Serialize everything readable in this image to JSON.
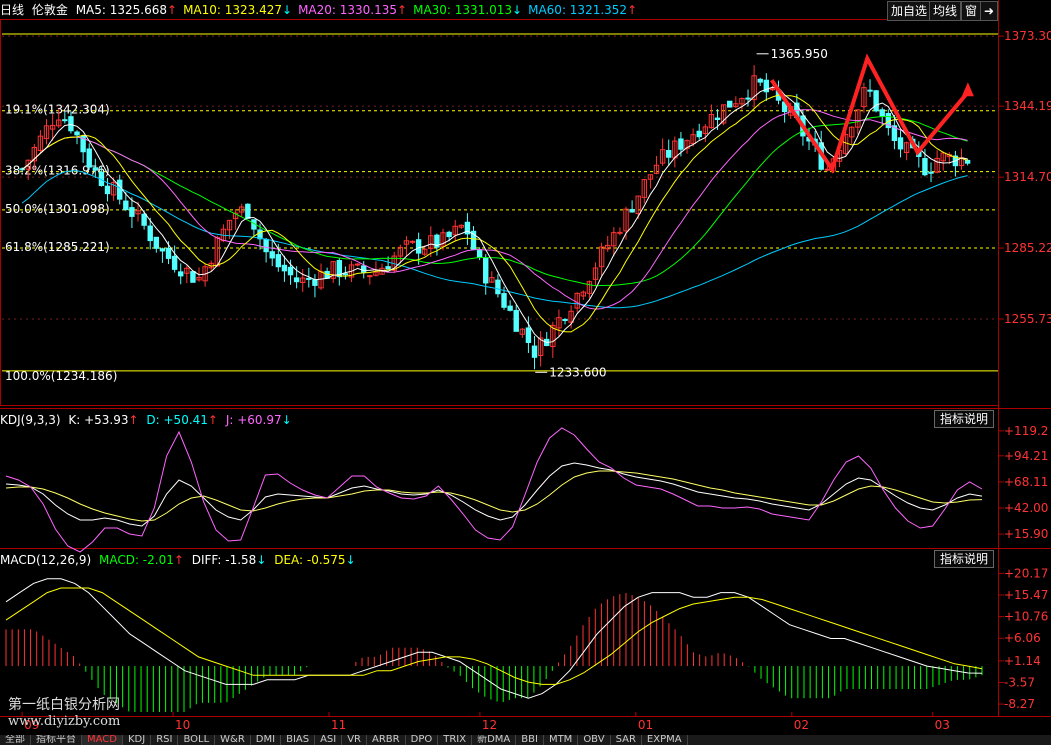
{
  "header": {
    "period": "日线",
    "name": "伦敦金",
    "ma": [
      {
        "label": "MA5: 1325.668",
        "arrow": "↑",
        "color": "#ffffff",
        "arrow_color": "#ff3333"
      },
      {
        "label": "MA10: 1323.427",
        "arrow": "↓",
        "color": "#ffff00",
        "arrow_color": "#00ffff"
      },
      {
        "label": "MA20: 1330.135",
        "arrow": "↑",
        "color": "#ff66ff",
        "arrow_color": "#ff3333"
      },
      {
        "label": "MA30: 1331.013",
        "arrow": "↓",
        "color": "#00ff00",
        "arrow_color": "#00ffff"
      },
      {
        "label": "MA60: 1321.352",
        "arrow": "↑",
        "color": "#00ccff",
        "arrow_color": "#ff3333"
      }
    ]
  },
  "toolbar": {
    "add_label": "加自选",
    "ma_label": "均线",
    "window_label": "窗",
    "arrow_label": "➜"
  },
  "price_axis": {
    "ticks": [
      "1373.303",
      "1344.194",
      "1314.707",
      "1285.221",
      "1255.734"
    ],
    "high_label": "1365.950",
    "low_label": "1233.600"
  },
  "fib_levels": [
    {
      "label": "19.1%(1342.304)",
      "value": 1342.304
    },
    {
      "label": "38.2%(1316.976)",
      "value": 1316.976
    },
    {
      "label": "50.0%(1301.098)",
      "value": 1301.098
    },
    {
      "label": "61.8%(1285.221)",
      "value": 1285.221
    },
    {
      "label": "100.0%(1234.186)",
      "value": 1234.186
    }
  ],
  "kdj": {
    "title": "KDJ(9,3,3)",
    "k": "K: +53.93",
    "k_arrow": "↑",
    "d": "D: +50.41",
    "d_arrow": "↑",
    "j": "J: +60.97",
    "j_arrow": "↓",
    "ticks": [
      "+119.2",
      "+94.21",
      "+68.11",
      "+42.00",
      "+15.90"
    ],
    "button": "指标说明"
  },
  "macd": {
    "title": "MACD(12,26,9)",
    "macd": "MACD: -2.01",
    "macd_arrow": "↑",
    "diff": "DIFF: -1.58",
    "diff_arrow": "↓",
    "dea": "DEA: -0.575",
    "dea_arrow": "↓",
    "ticks": [
      "+20.17",
      "+15.47",
      "+10.76",
      "+6.06",
      "+1.14",
      "-3.57",
      "-8.27"
    ],
    "button": "指标说明"
  },
  "x_axis": {
    "labels": [
      "09",
      "10",
      "11",
      "12",
      "01",
      "02",
      "03"
    ]
  },
  "watermark": {
    "line1": "第一纸白银分析网",
    "line2": "www.diyizby.com"
  },
  "tabs": [
    "全部",
    "指标平台",
    "MACD",
    "KDJ",
    "RSI",
    "BOLL",
    "W&R",
    "DMI",
    "BIAS",
    "ASI",
    "VR",
    "ARBR",
    "DPO",
    "TRIX",
    "新DMA",
    "BBI",
    "MTM",
    "OBV",
    "SAR",
    "EXPMA"
  ],
  "active_tab": "MACD",
  "colors": {
    "up": "#ff3333",
    "down": "#54ffff",
    "ma5": "#ffffff",
    "ma10": "#ffff00",
    "ma20": "#ff66ff",
    "ma30": "#00ff00",
    "ma60": "#00ccff",
    "grid": "#aa0000",
    "fib": "#ffff00",
    "annotation": "#ff2222"
  },
  "chart_data": [
    {
      "type": "candlestick",
      "title": "伦敦金 日线",
      "ylim": [
        1220,
        1380
      ],
      "x_labels": [
        "09",
        "10",
        "11",
        "12",
        "01",
        "02",
        "03"
      ],
      "annotations": [
        {
          "label": "1365.950",
          "x": "2018-01-25",
          "y": 1365.95
        },
        {
          "label": "1233.600",
          "x": "2017-12-12",
          "y": 1233.6
        }
      ],
      "close_path": [
        [
          "2017-09-01",
          1318
        ],
        [
          "2017-09-08",
          1342
        ],
        [
          "2017-09-11",
          1336
        ],
        [
          "2017-09-15",
          1318
        ],
        [
          "2017-09-20",
          1307
        ],
        [
          "2017-09-25",
          1295
        ],
        [
          "2017-09-29",
          1283
        ],
        [
          "2017-10-06",
          1272
        ],
        [
          "2017-10-13",
          1300
        ],
        [
          "2017-10-16",
          1301
        ],
        [
          "2017-10-20",
          1281
        ],
        [
          "2017-10-26",
          1271
        ],
        [
          "2017-11-02",
          1276
        ],
        [
          "2017-11-10",
          1275
        ],
        [
          "2017-11-16",
          1285
        ],
        [
          "2017-11-24",
          1288
        ],
        [
          "2017-11-28",
          1295
        ],
        [
          "2017-12-01",
          1278
        ],
        [
          "2017-12-06",
          1262
        ],
        [
          "2017-12-12",
          1242
        ],
        [
          "2017-12-20",
          1265
        ],
        [
          "2017-12-28",
          1292
        ],
        [
          "2018-01-05",
          1320
        ],
        [
          "2018-01-15",
          1338
        ],
        [
          "2018-01-25",
          1354
        ],
        [
          "2018-02-01",
          1340
        ],
        [
          "2018-02-08",
          1318
        ],
        [
          "2018-02-16",
          1352
        ],
        [
          "2018-02-21",
          1330
        ],
        [
          "2018-02-28",
          1318
        ],
        [
          "2018-03-02",
          1323
        ],
        [
          "2018-03-09",
          1322
        ]
      ],
      "moving_averages": {
        "MA5": 1325.668,
        "MA10": 1323.427,
        "MA20": 1330.135,
        "MA30": 1331.013,
        "MA60": 1321.352
      },
      "fibonacci": [
        {
          "pct": "19.1%",
          "value": 1342.304
        },
        {
          "pct": "38.2%",
          "value": 1316.976
        },
        {
          "pct": "50.0%",
          "value": 1301.098
        },
        {
          "pct": "61.8%",
          "value": 1285.221
        },
        {
          "pct": "100.0%",
          "value": 1234.186
        }
      ]
    },
    {
      "type": "line",
      "title": "KDJ(9,3,3)",
      "ylim": [
        5,
        125
      ],
      "series": [
        {
          "name": "K",
          "last": 53.93,
          "values": [
            66,
            65,
            63,
            56,
            45,
            36,
            30,
            30,
            32,
            30,
            26,
            24,
            34,
            56,
            70,
            64,
            52,
            40,
            33,
            30,
            40,
            53,
            56,
            55,
            54,
            53,
            52,
            57,
            62,
            64,
            61,
            59,
            56,
            55,
            56,
            60,
            55,
            48,
            40,
            34,
            30,
            33,
            45,
            60,
            74,
            84,
            87,
            85,
            82,
            80,
            76,
            73,
            71,
            69,
            66,
            62,
            58,
            56,
            54,
            52,
            51,
            49,
            46,
            44,
            42,
            40,
            46,
            56,
            66,
            72,
            70,
            62,
            54,
            47,
            42,
            40,
            45,
            52,
            56,
            53.93
          ]
        },
        {
          "name": "D",
          "last": 50.41,
          "values": [
            62,
            63,
            63,
            61,
            57,
            52,
            46,
            41,
            37,
            34,
            31,
            29,
            30,
            37,
            46,
            52,
            54,
            50,
            45,
            40,
            39,
            42,
            46,
            49,
            51,
            52,
            52,
            54,
            56,
            59,
            60,
            60,
            58,
            57,
            57,
            58,
            57,
            54,
            50,
            45,
            40,
            38,
            40,
            46,
            55,
            65,
            73,
            77,
            79,
            79,
            78,
            77,
            75,
            73,
            71,
            68,
            65,
            62,
            60,
            57,
            55,
            53,
            51,
            49,
            47,
            45,
            45,
            49,
            55,
            61,
            64,
            63,
            60,
            56,
            52,
            48,
            47,
            48,
            50,
            50.41
          ]
        },
        {
          "name": "J",
          "last": 60.97,
          "values": [
            74,
            70,
            63,
            46,
            21,
            4,
            -2,
            8,
            22,
            22,
            16,
            14,
            42,
            94,
            118,
            88,
            48,
            20,
            9,
            10,
            42,
            75,
            76,
            67,
            60,
            55,
            52,
            63,
            74,
            74,
            63,
            57,
            52,
            51,
            54,
            64,
            51,
            36,
            20,
            12,
            10,
            23,
            55,
            88,
            112,
            122,
            115,
            101,
            88,
            82,
            72,
            65,
            63,
            61,
            56,
            50,
            44,
            44,
            42,
            42,
            43,
            41,
            36,
            34,
            32,
            30,
            48,
            70,
            88,
            94,
            82,
            60,
            42,
            29,
            22,
            24,
            41,
            60,
            68,
            60.97
          ]
        }
      ],
      "ticks": [
        119.2,
        94.21,
        68.11,
        42.0,
        15.9
      ]
    },
    {
      "type": "bar",
      "title": "MACD(12,26,9)",
      "ylim": [
        -10,
        22
      ],
      "series": [
        {
          "name": "DIFF",
          "last": -1.58,
          "values": [
            14,
            16,
            18,
            19,
            19,
            18,
            16,
            13,
            10,
            7,
            5,
            3,
            1,
            -1,
            -2,
            -3,
            -4,
            -4,
            -4,
            -3,
            -3,
            -3,
            -2,
            -2,
            -2,
            -2,
            -1,
            0,
            1,
            2,
            3,
            3,
            2,
            1,
            -1,
            -3,
            -5,
            -6,
            -7,
            -6,
            -4,
            -1,
            3,
            7,
            10,
            13,
            15,
            16,
            16,
            16,
            15,
            15,
            16,
            16,
            15,
            13,
            11,
            9,
            8,
            7,
            6,
            6,
            5,
            4,
            3,
            2,
            1,
            0,
            -0.5,
            -1,
            -1.5,
            -1.58
          ]
        },
        {
          "name": "DEA",
          "last": -0.575,
          "values": [
            10,
            12,
            14,
            16,
            17,
            17,
            17,
            16,
            14,
            12,
            10,
            8,
            6,
            4,
            2,
            1,
            0,
            -1,
            -2,
            -2,
            -2,
            -2,
            -2,
            -2,
            -2,
            -2,
            -2,
            -1,
            -1,
            0,
            1,
            1.5,
            2,
            2,
            1.5,
            0.5,
            -1,
            -2.5,
            -3.5,
            -4,
            -4,
            -3,
            -1.5,
            0.5,
            2.5,
            5,
            7.5,
            9.5,
            11,
            12.5,
            13.5,
            14,
            14.5,
            15,
            15,
            14.5,
            13.5,
            12.5,
            11.5,
            10.5,
            9.5,
            8.5,
            7.5,
            6.5,
            5.5,
            4.5,
            3.5,
            2.5,
            1.5,
            0.5,
            0,
            -0.575
          ]
        },
        {
          "name": "MACD",
          "last": -2.01
        }
      ],
      "ticks": [
        20.17,
        15.47,
        10.76,
        6.06,
        1.14,
        -3.57,
        -8.27
      ]
    }
  ]
}
